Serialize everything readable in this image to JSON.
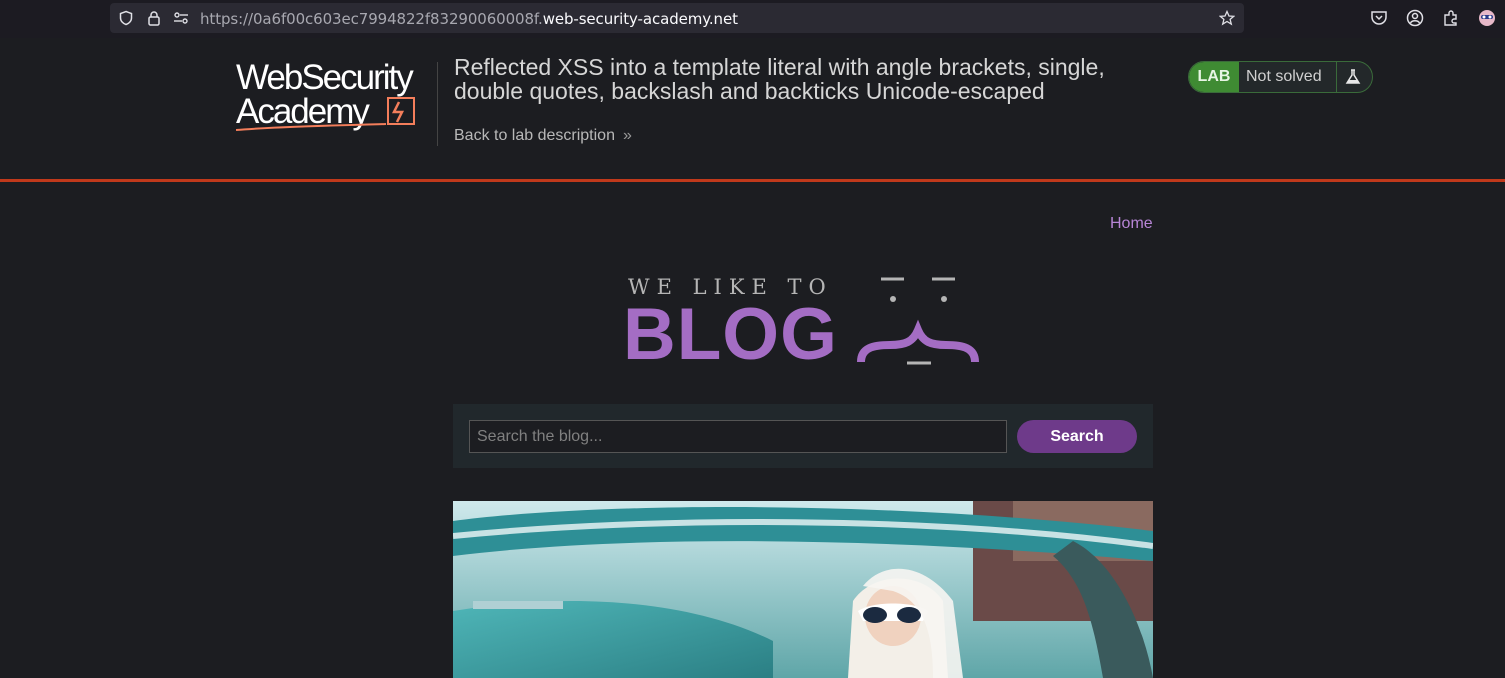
{
  "browser": {
    "url_prefix": "https://0a6f00c603ec7994822f83290060008f.",
    "url_host": "web-security-academy.net"
  },
  "lab": {
    "logo_line1": "WebSecurity",
    "logo_line2": "Academy",
    "title": "Reflected XSS into a template literal with angle brackets, single, double quotes, backslash and backticks Unicode-escaped",
    "back_link": "Back to lab description",
    "badge": "LAB",
    "status": "Not solved"
  },
  "blog": {
    "nav_home": "Home",
    "tagline": "WE LIKE TO",
    "brand": "BLOG",
    "search_placeholder": "Search the blog...",
    "search_button": "Search"
  },
  "colors": {
    "accent_purple": "#a46dc4",
    "lab_green": "#3f8b33",
    "header_rule": "#c0391b",
    "background": "#1c1d21"
  }
}
